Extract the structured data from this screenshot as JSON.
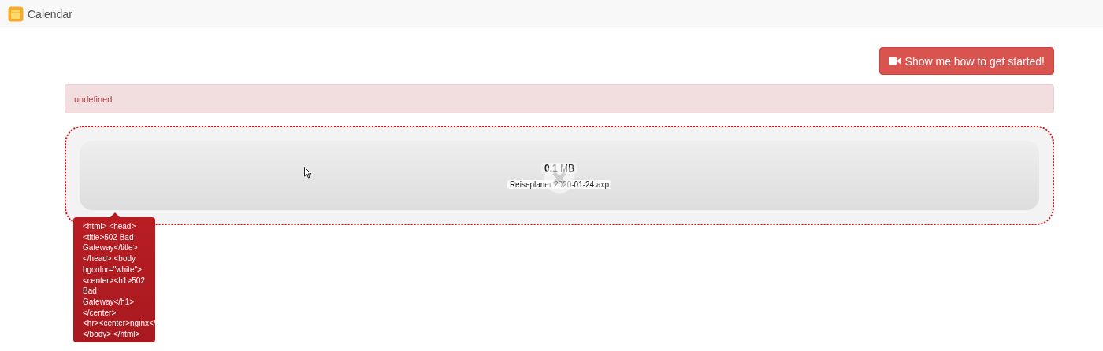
{
  "app": {
    "title": "Calendar"
  },
  "start_button": {
    "label": "Show me how to get started!"
  },
  "alert": {
    "message": "undefined"
  },
  "upload": {
    "file_size": "**0.1** MB",
    "file_name": "Reiseplaner 2020-01-24.axp",
    "failed": true,
    "error_tooltip": [
      "<html> <head>",
      "<title>502 Bad",
      "Gateway</title>",
      "</head> <body",
      "bgcolor=\"white\">",
      "<center><h1>502",
      "Bad",
      "Gateway</h1>",
      "</center>",
      "<hr><center>nginx</",
      "</body> </html>"
    ]
  }
}
